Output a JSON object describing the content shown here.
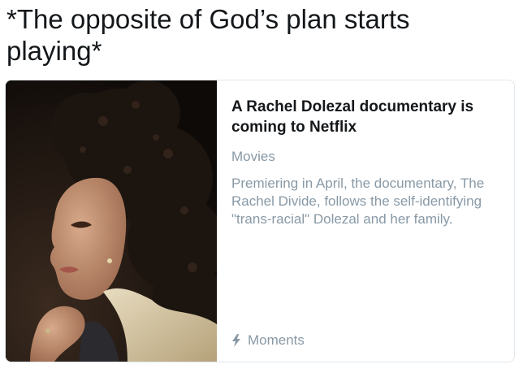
{
  "caption": "*The opposite of God’s plan starts playing*",
  "card": {
    "headline": "A Rachel Dolezal documentary is coming to Netflix",
    "category": "Movies",
    "description": "Premiering in April, the documentary, The Rachel Divide, follows the self-identifying \"trans-racial\" Dolezal and her family.",
    "footer": {
      "icon": "lightning-bolt-icon",
      "label": "Moments"
    },
    "image": {
      "subject": "portrait-photo"
    }
  },
  "colors": {
    "text_primary": "#14171a",
    "text_secondary": "#8899a6",
    "card_border": "#e1e8ed"
  }
}
